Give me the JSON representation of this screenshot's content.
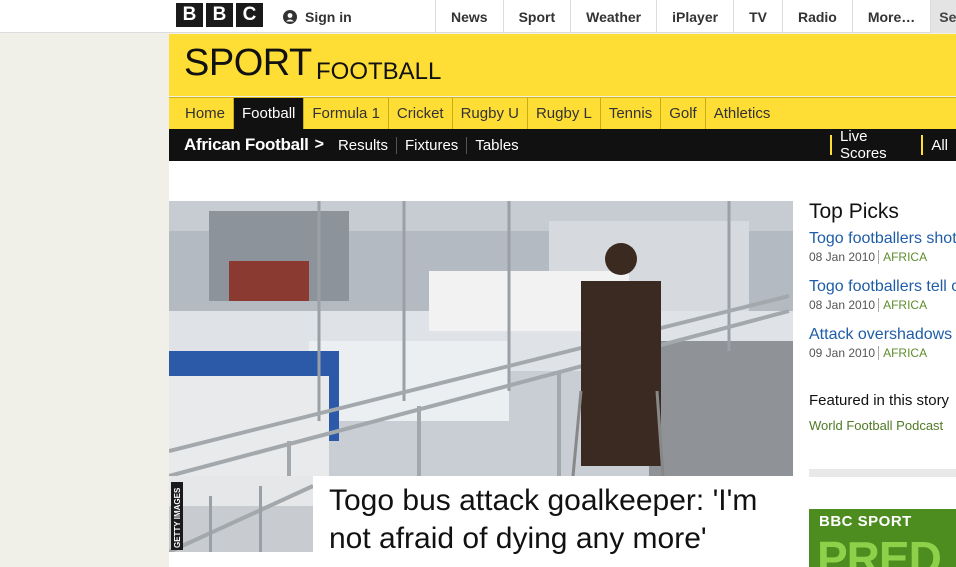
{
  "topbar": {
    "logo": [
      "B",
      "B",
      "C"
    ],
    "signin_label": "Sign in",
    "nav": [
      "News",
      "Sport",
      "Weather",
      "iPlayer",
      "TV",
      "Radio",
      "More…"
    ],
    "search_label": "Sea"
  },
  "header": {
    "title": "SPORT",
    "section": "FOOTBALL"
  },
  "mainnav": [
    "Home",
    "Football",
    "Formula 1",
    "Cricket",
    "Rugby U",
    "Rugby L",
    "Tennis",
    "Golf",
    "Athletics"
  ],
  "mainnav_active": "Football",
  "subnav": {
    "section": "African Football",
    "arrow": ">",
    "links": [
      "Results",
      "Fixtures",
      "Tables"
    ],
    "right": [
      "Live Scores",
      "All"
    ]
  },
  "story": {
    "headline": "Togo bus attack goalkeeper: 'I'm not afraid of dying any more'",
    "credit": "GETTY IMAGES"
  },
  "top_picks": {
    "title": "Top Picks",
    "items": [
      {
        "title": "Togo footballers shot",
        "date": "08 Jan 2010",
        "tag": "AFRICA"
      },
      {
        "title": "Togo footballers tell o",
        "date": "08 Jan 2010",
        "tag": "AFRICA"
      },
      {
        "title": "Attack overshadows",
        "date": "09 Jan 2010",
        "tag": "AFRICA"
      }
    ]
  },
  "featured": {
    "label": "Featured in this story",
    "link": "World Football Podcast"
  },
  "promo": {
    "label": "BBC SPORT",
    "big": "PRED"
  },
  "colors": {
    "sport_yellow": "#fedd35",
    "nav_black": "#111111",
    "link_blue": "#1f5da8",
    "tag_green": "#5d8d2d"
  }
}
